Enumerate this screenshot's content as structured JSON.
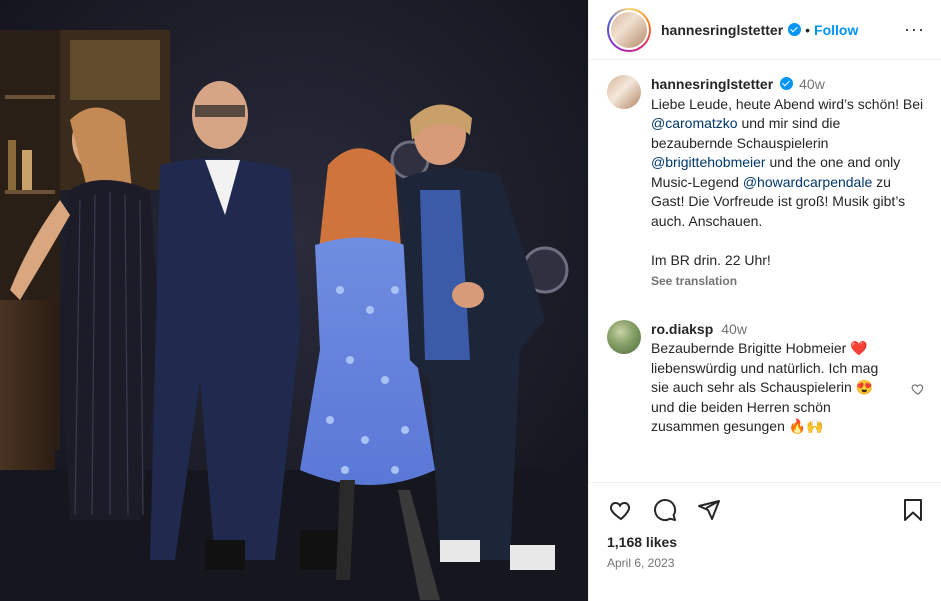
{
  "post": {
    "username": "hannesringlstetter",
    "follow_label": "Follow",
    "dot": "•",
    "more_label": "···"
  },
  "caption": {
    "username": "hannesringlstetter",
    "time": "40w",
    "text_1": "Liebe Leude, heute Abend wird’s schön! Bei ",
    "mention_1": "@caromatzko",
    "text_2": " und mir sind die bezaubernde Schauspielerin ",
    "mention_2": "@brigittehobmeier",
    "text_3": " und the one and only Music-Legend ",
    "mention_3": "@howardcarpendale",
    "text_4": " zu Gast! Die Vorfreude ist groß! Musik gibt’s auch. Anschauen.\n\nIm BR drin. 22 Uhr!",
    "see_translation": "See translation"
  },
  "comment": {
    "username": "ro.diaksp",
    "time": "40w",
    "text_1": "Bezaubernde Brigitte Hobmeier ",
    "emoji_1": "❤️",
    "text_2": " liebenswürdig und natürlich. Ich mag sie auch sehr als Schauspielerin ",
    "emoji_2": "😍",
    "text_3": " und die beiden Herren schön zusammen gesungen ",
    "emoji_3": "🔥🙌"
  },
  "footer": {
    "likes": "1,168 likes",
    "date": "April 6, 2023"
  },
  "colors": {
    "accent": "#0095f6",
    "mention": "#00376b",
    "muted": "#737373"
  },
  "icons": [
    "heart-icon",
    "comment-icon",
    "share-icon",
    "bookmark-icon",
    "verified-icon",
    "more-icon"
  ]
}
